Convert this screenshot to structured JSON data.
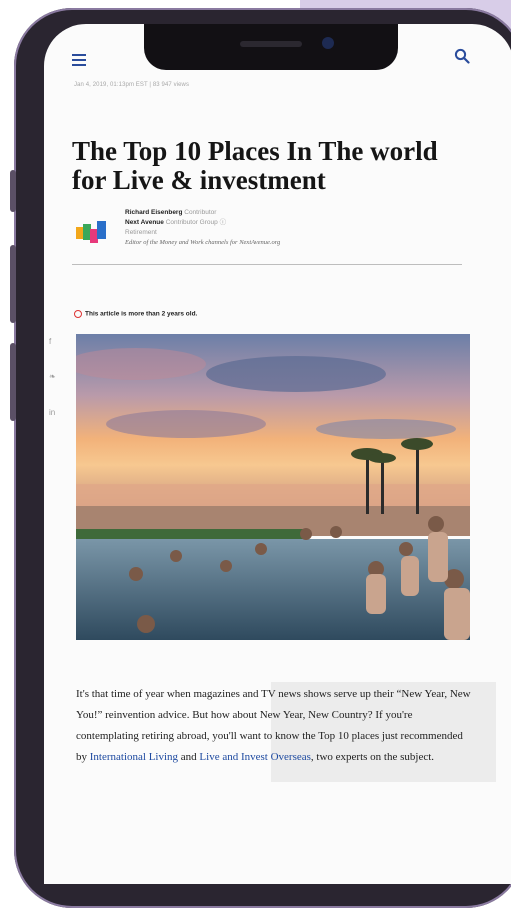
{
  "article": {
    "meta": "Jan 4, 2019, 01:13pm EST | 83 947 views",
    "title": "The Top 10 Places In The world for Live & investment",
    "author_name": "Richard Eisenberg",
    "author_role": "Contributor",
    "outlet_name": "Next Avenue",
    "outlet_role": "Contributor Group",
    "topic": "Retirement",
    "bio": "Editor of the Money and Work channels for NextAvenue.org",
    "notice": "This article is more than 2 years old.",
    "body_part1": "It's that time of year when magazines and TV news shows serve up their “New Year, New You!” reinvention advice. But how about New Year, New Country? If you're contemplating retiring abroad, you'll want to know the Top 10 places just recommended by ",
    "link1": "International Living",
    "body_part2": " and ",
    "link2": "Live and Invest Overseas",
    "body_part3": ", two experts on the subject."
  },
  "social": {
    "facebook": "f",
    "twitter": "❧",
    "linkedin": "in"
  },
  "icons": {
    "menu": "menu-icon",
    "search": "search-icon",
    "warning": "warning-icon"
  },
  "colors": {
    "accent": "#2a4c9c",
    "link": "#1e4aa0",
    "warning": "#dd3333"
  }
}
